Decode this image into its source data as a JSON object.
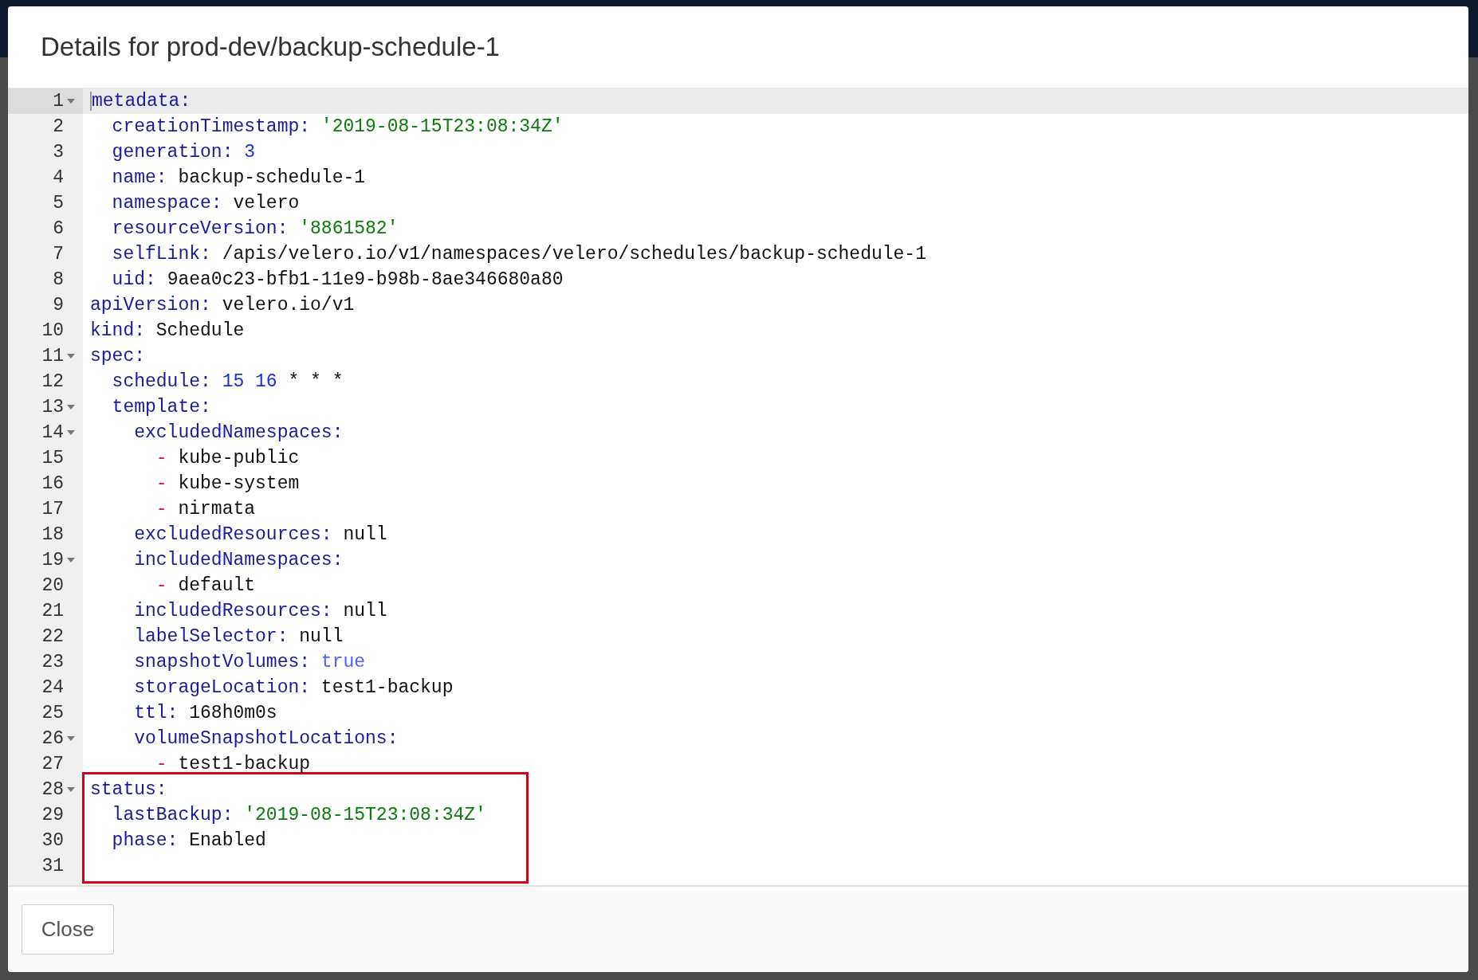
{
  "dialog": {
    "title": "Details for prod-dev/backup-schedule-1",
    "editor": {
      "lines": [
        {
          "number": "1",
          "foldable": true,
          "active": true,
          "highlighted": false,
          "tokens": [
            {
              "kind": "key",
              "text": "metadata:"
            }
          ]
        },
        {
          "number": "2",
          "foldable": false,
          "active": false,
          "highlighted": false,
          "tokens": [
            {
              "kind": "key",
              "text": "  creationTimestamp:"
            },
            {
              "kind": "string",
              "text": " '2019-08-15T23:08:34Z'"
            }
          ]
        },
        {
          "number": "3",
          "foldable": false,
          "active": false,
          "highlighted": false,
          "tokens": [
            {
              "kind": "key",
              "text": "  generation:"
            },
            {
              "kind": "number",
              "text": " 3"
            }
          ]
        },
        {
          "number": "4",
          "foldable": false,
          "active": false,
          "highlighted": false,
          "tokens": [
            {
              "kind": "key",
              "text": "  name:"
            },
            {
              "kind": "plain",
              "text": " backup-schedule-1"
            }
          ]
        },
        {
          "number": "5",
          "foldable": false,
          "active": false,
          "highlighted": false,
          "tokens": [
            {
              "kind": "key",
              "text": "  namespace:"
            },
            {
              "kind": "plain",
              "text": " velero"
            }
          ]
        },
        {
          "number": "6",
          "foldable": false,
          "active": false,
          "highlighted": false,
          "tokens": [
            {
              "kind": "key",
              "text": "  resourceVersion:"
            },
            {
              "kind": "string",
              "text": " '8861582'"
            }
          ]
        },
        {
          "number": "7",
          "foldable": false,
          "active": false,
          "highlighted": false,
          "tokens": [
            {
              "kind": "key",
              "text": "  selfLink:"
            },
            {
              "kind": "plain",
              "text": " /apis/velero.io/v1/namespaces/velero/schedules/backup-schedule-1"
            }
          ]
        },
        {
          "number": "8",
          "foldable": false,
          "active": false,
          "highlighted": false,
          "tokens": [
            {
              "kind": "key",
              "text": "  uid:"
            },
            {
              "kind": "plain",
              "text": " 9aea0c23-bfb1-11e9-b98b-8ae346680a80"
            }
          ]
        },
        {
          "number": "9",
          "foldable": false,
          "active": false,
          "highlighted": false,
          "tokens": [
            {
              "kind": "key",
              "text": "apiVersion:"
            },
            {
              "kind": "plain",
              "text": " velero.io/v1"
            }
          ]
        },
        {
          "number": "10",
          "foldable": false,
          "active": false,
          "highlighted": false,
          "tokens": [
            {
              "kind": "key",
              "text": "kind:"
            },
            {
              "kind": "plain",
              "text": " Schedule"
            }
          ]
        },
        {
          "number": "11",
          "foldable": true,
          "active": false,
          "highlighted": false,
          "tokens": [
            {
              "kind": "key",
              "text": "spec:"
            }
          ]
        },
        {
          "number": "12",
          "foldable": false,
          "active": false,
          "highlighted": false,
          "tokens": [
            {
              "kind": "key",
              "text": "  schedule:"
            },
            {
              "kind": "number",
              "text": " 15 16"
            },
            {
              "kind": "plain",
              "text": " * * *"
            }
          ]
        },
        {
          "number": "13",
          "foldable": true,
          "active": false,
          "highlighted": false,
          "tokens": [
            {
              "kind": "key",
              "text": "  template:"
            }
          ]
        },
        {
          "number": "14",
          "foldable": true,
          "active": false,
          "highlighted": false,
          "tokens": [
            {
              "kind": "key",
              "text": "    excludedNamespaces:"
            }
          ]
        },
        {
          "number": "15",
          "foldable": false,
          "active": false,
          "highlighted": false,
          "tokens": [
            {
              "kind": "dash",
              "text": "      -"
            },
            {
              "kind": "plain",
              "text": " kube-public"
            }
          ]
        },
        {
          "number": "16",
          "foldable": false,
          "active": false,
          "highlighted": false,
          "tokens": [
            {
              "kind": "dash",
              "text": "      -"
            },
            {
              "kind": "plain",
              "text": " kube-system"
            }
          ]
        },
        {
          "number": "17",
          "foldable": false,
          "active": false,
          "highlighted": false,
          "tokens": [
            {
              "kind": "dash",
              "text": "      -"
            },
            {
              "kind": "plain",
              "text": " nirmata"
            }
          ]
        },
        {
          "number": "18",
          "foldable": false,
          "active": false,
          "highlighted": false,
          "tokens": [
            {
              "kind": "key",
              "text": "    excludedResources:"
            },
            {
              "kind": "plain",
              "text": " null"
            }
          ]
        },
        {
          "number": "19",
          "foldable": true,
          "active": false,
          "highlighted": false,
          "tokens": [
            {
              "kind": "key",
              "text": "    includedNamespaces:"
            }
          ]
        },
        {
          "number": "20",
          "foldable": false,
          "active": false,
          "highlighted": false,
          "tokens": [
            {
              "kind": "dash",
              "text": "      -"
            },
            {
              "kind": "plain",
              "text": " default"
            }
          ]
        },
        {
          "number": "21",
          "foldable": false,
          "active": false,
          "highlighted": false,
          "tokens": [
            {
              "kind": "key",
              "text": "    includedResources:"
            },
            {
              "kind": "plain",
              "text": " null"
            }
          ]
        },
        {
          "number": "22",
          "foldable": false,
          "active": false,
          "highlighted": false,
          "tokens": [
            {
              "kind": "key",
              "text": "    labelSelector:"
            },
            {
              "kind": "plain",
              "text": " null"
            }
          ]
        },
        {
          "number": "23",
          "foldable": false,
          "active": false,
          "highlighted": false,
          "tokens": [
            {
              "kind": "key",
              "text": "    snapshotVolumes:"
            },
            {
              "kind": "bool",
              "text": " true"
            }
          ]
        },
        {
          "number": "24",
          "foldable": false,
          "active": false,
          "highlighted": false,
          "tokens": [
            {
              "kind": "key",
              "text": "    storageLocation:"
            },
            {
              "kind": "plain",
              "text": " test1-backup"
            }
          ]
        },
        {
          "number": "25",
          "foldable": false,
          "active": false,
          "highlighted": false,
          "tokens": [
            {
              "kind": "key",
              "text": "    ttl:"
            },
            {
              "kind": "plain",
              "text": " 168h0m0s"
            }
          ]
        },
        {
          "number": "26",
          "foldable": true,
          "active": false,
          "highlighted": false,
          "tokens": [
            {
              "kind": "key",
              "text": "    volumeSnapshotLocations:"
            }
          ]
        },
        {
          "number": "27",
          "foldable": false,
          "active": false,
          "highlighted": false,
          "tokens": [
            {
              "kind": "dash",
              "text": "      -"
            },
            {
              "kind": "plain",
              "text": " test1-backup"
            }
          ]
        },
        {
          "number": "28",
          "foldable": true,
          "active": false,
          "highlighted": true,
          "tokens": [
            {
              "kind": "key",
              "text": "status:"
            }
          ]
        },
        {
          "number": "29",
          "foldable": false,
          "active": false,
          "highlighted": true,
          "tokens": [
            {
              "kind": "key",
              "text": "  lastBackup:"
            },
            {
              "kind": "string",
              "text": " '2019-08-15T23:08:34Z'"
            }
          ]
        },
        {
          "number": "30",
          "foldable": false,
          "active": false,
          "highlighted": true,
          "tokens": [
            {
              "kind": "key",
              "text": "  phase:"
            },
            {
              "kind": "plain",
              "text": " Enabled"
            }
          ]
        },
        {
          "number": "31",
          "foldable": false,
          "active": false,
          "highlighted": true
        }
      ]
    },
    "buttons": [
      {
        "label": "Close"
      }
    ]
  }
}
